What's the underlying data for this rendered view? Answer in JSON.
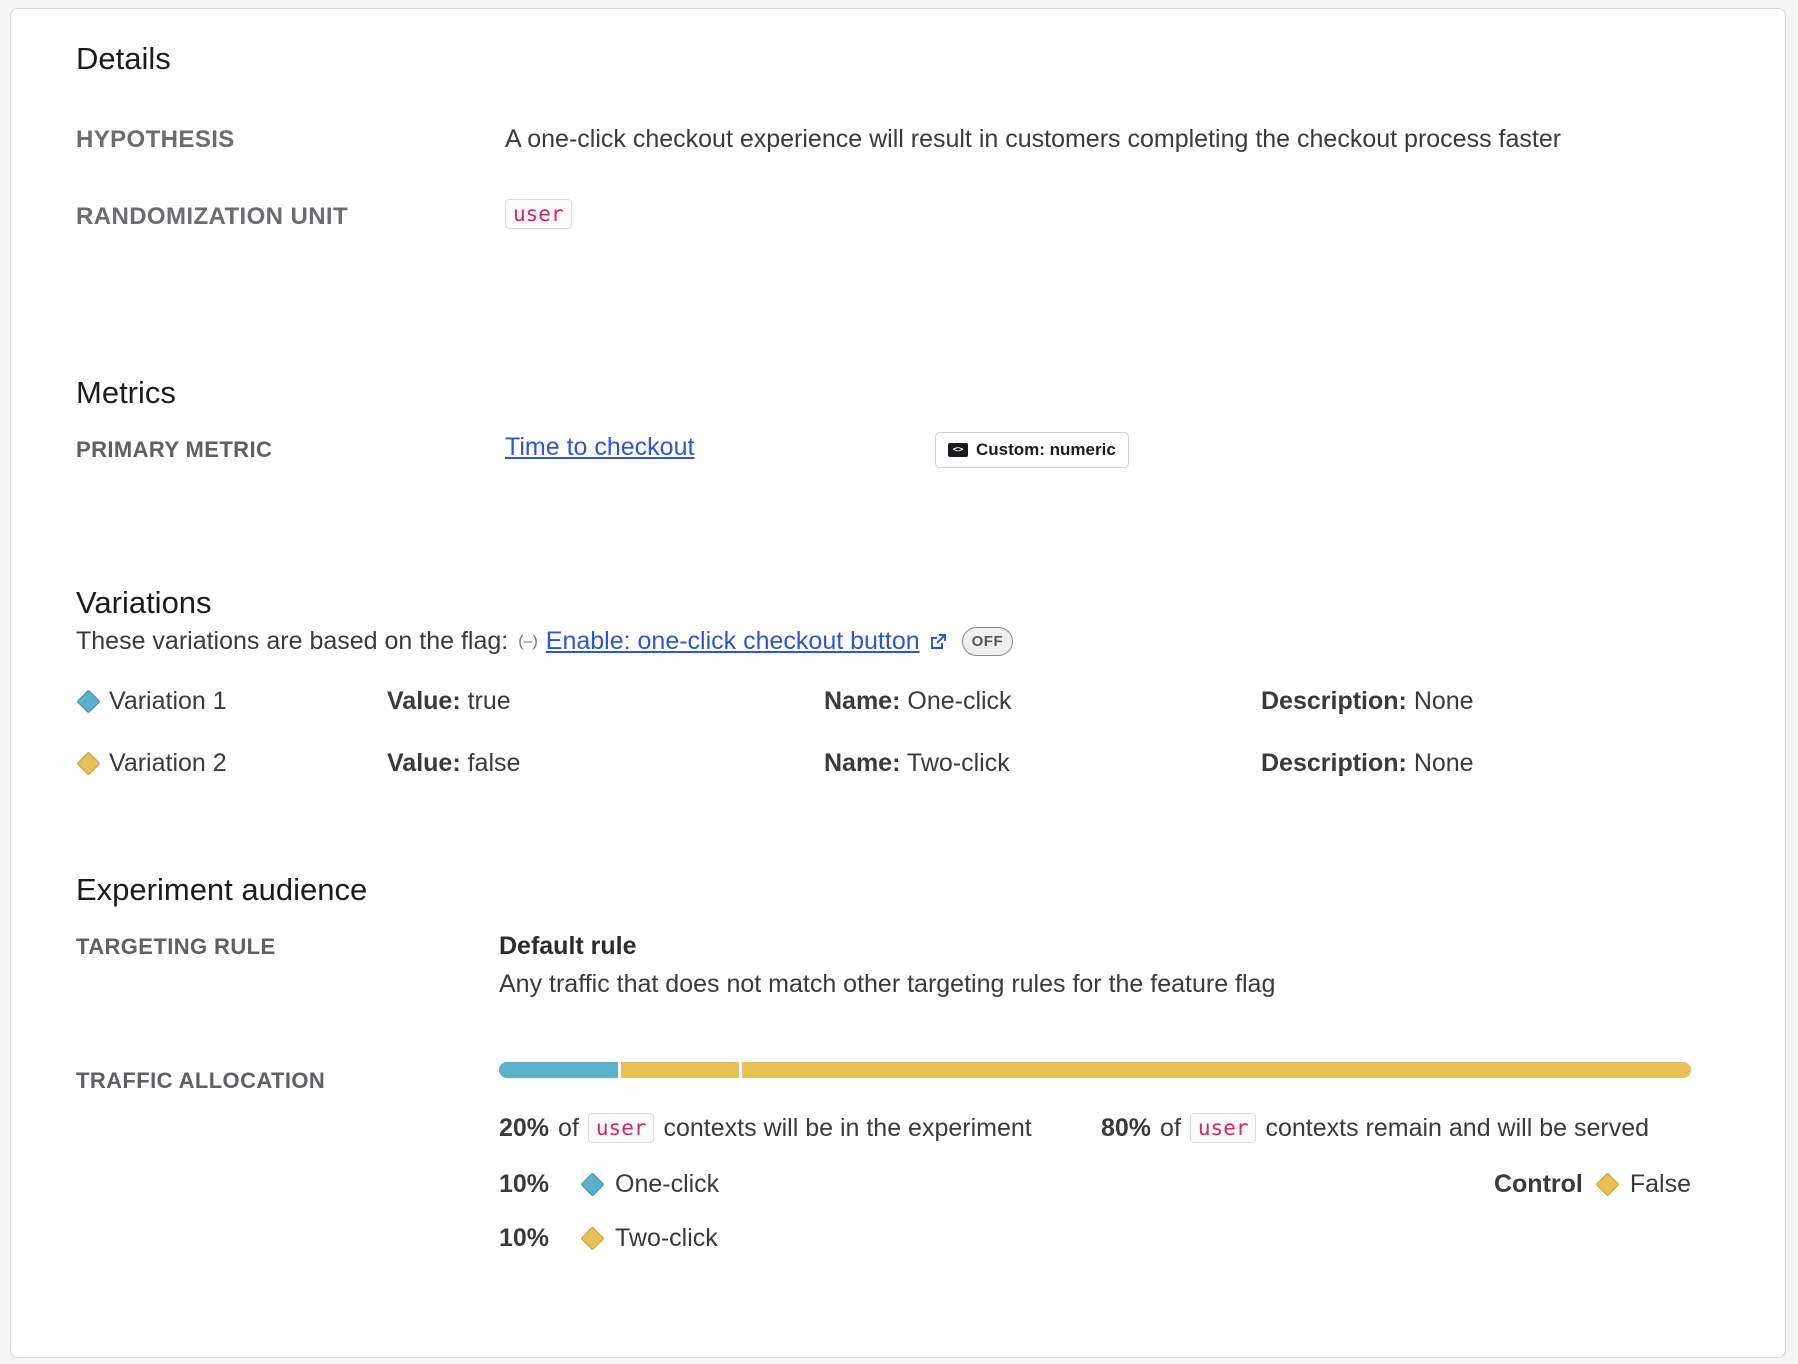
{
  "details": {
    "title": "Details",
    "hypothesis_label": "HYPOTHESIS",
    "hypothesis_value": "A one-click checkout experience will result in customers completing the checkout process faster",
    "randomization_label": "RANDOMIZATION UNIT",
    "randomization_value": "user"
  },
  "metrics": {
    "title": "Metrics",
    "primary_label": "PRIMARY METRIC",
    "primary_link": "Time to checkout",
    "badge_text": "Custom: numeric",
    "badge_icon": "code-icon"
  },
  "variations": {
    "title": "Variations",
    "intro": "These variations are based on the flag:",
    "flag_icon": "flag-toggle-icon",
    "flag_link": "Enable: one-click checkout button",
    "flag_status": "OFF",
    "value_label": "Value:",
    "name_label": "Name:",
    "description_label": "Description:",
    "items": [
      {
        "label": "Variation 1",
        "value": "true",
        "name": "One-click",
        "description": "None",
        "color": "#5bb0c9"
      },
      {
        "label": "Variation 2",
        "value": "false",
        "name": "Two-click",
        "description": "None",
        "color": "#e7c158"
      }
    ]
  },
  "audience": {
    "title": "Experiment audience",
    "targeting_label": "TARGETING RULE",
    "rule_title": "Default rule",
    "rule_desc": "Any traffic that does not match other targeting rules for the feature flag",
    "traffic_label": "TRAFFIC ALLOCATION",
    "allocation": [
      {
        "name": "One-click",
        "percent": 10,
        "color": "#5bb0c9"
      },
      {
        "name": "Two-click",
        "percent": 10,
        "color": "#e7c158"
      },
      {
        "name": "Control",
        "percent": 80,
        "color": "#e7c158"
      }
    ],
    "in_experiment_pct": "20%",
    "of_text": "of",
    "unit": "user",
    "in_experiment_text": "contexts will be in the experiment",
    "remain_pct": "80%",
    "remain_text": "contexts remain and will be served",
    "rows": [
      {
        "pct": "10%",
        "name": "One-click"
      },
      {
        "pct": "10%",
        "name": "Two-click"
      }
    ],
    "control_label": "Control",
    "control_value": "False"
  }
}
